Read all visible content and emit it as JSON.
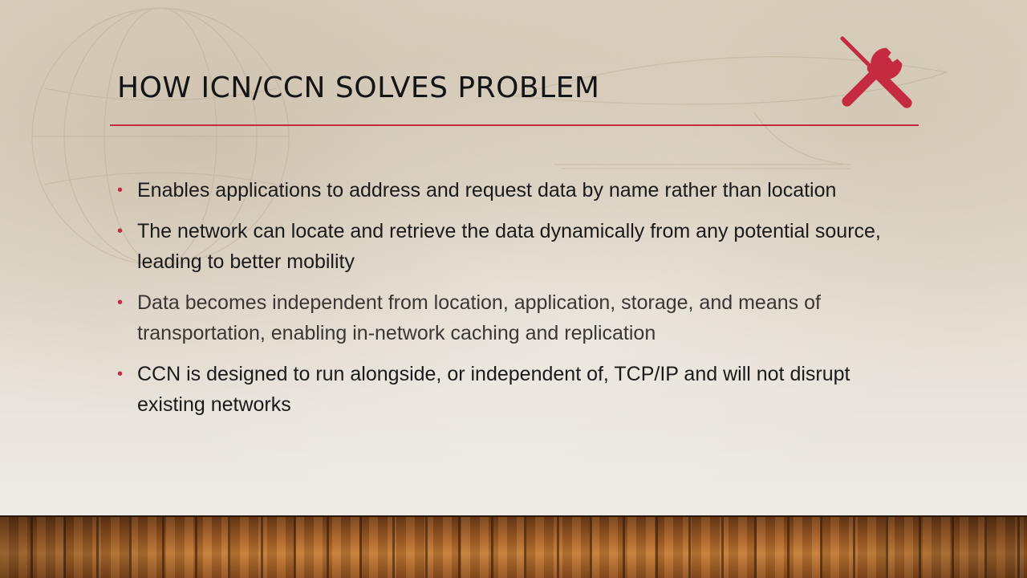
{
  "slide": {
    "title": "HOW ICN/CCN SOLVES PROBLEM",
    "icon": "tools-icon",
    "accent_color": "#c42a40",
    "bullet_marker": "•",
    "bullets": [
      "Enables applications to address and request data by name rather than location",
      "The network can locate and retrieve the data dynamically from any potential source, leading to better mobility",
      "Data becomes independent from location, application, storage, and means of transportation, enabling in-network caching and replication",
      "CCN is designed to run alongside, or independent of, TCP/IP and will not disrupt existing networks"
    ]
  }
}
